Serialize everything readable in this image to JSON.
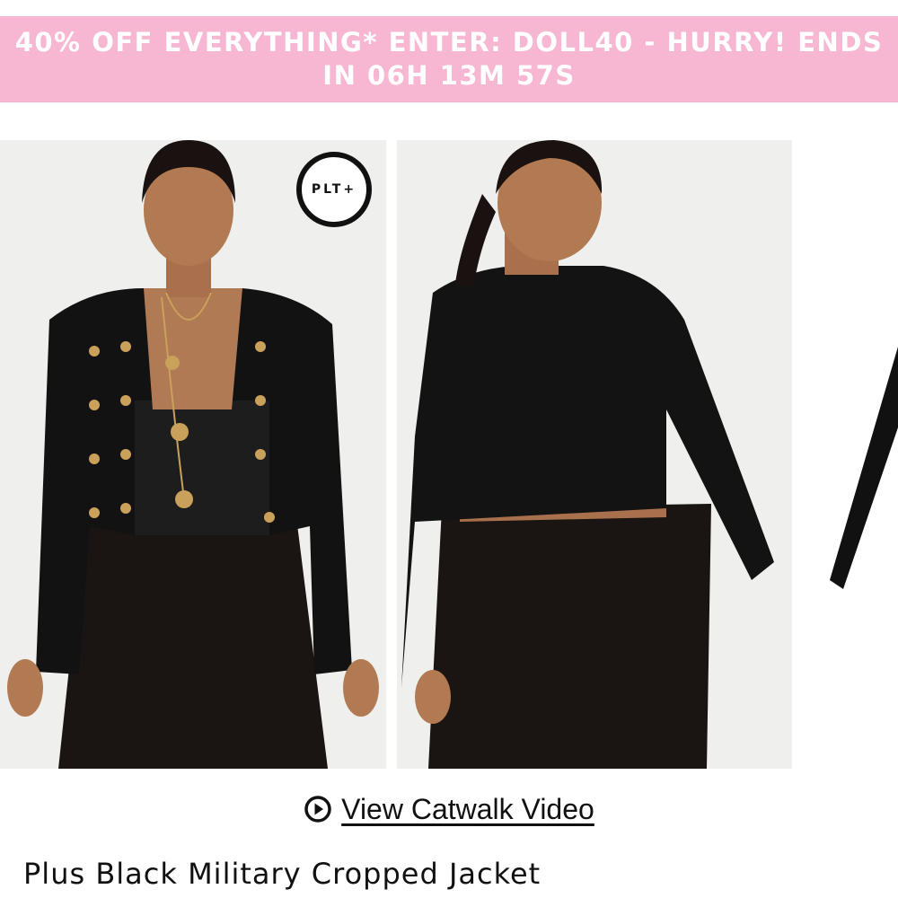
{
  "promo": {
    "line1": "40% OFF EVERYTHING* ENTER: DOLL40 - HURRY! ENDS",
    "line2": "IN 06H 13M 57S"
  },
  "gallery": {
    "badge": "PLT+",
    "images": [
      {
        "alt": "Plus Black Military Cropped Jacket - front"
      },
      {
        "alt": "Plus Black Military Cropped Jacket - back"
      },
      {
        "alt": "Plus Black Military Cropped Jacket - side"
      }
    ]
  },
  "video": {
    "label": "View Catwalk Video",
    "icon": "play-circle-icon"
  },
  "share": {
    "icon": "share-icon"
  },
  "product": {
    "title": "Plus Black Military Cropped Jacket"
  },
  "colors": {
    "promo_bg": "#f7b6d2",
    "promo_text": "#ffffff",
    "text": "#111111"
  }
}
